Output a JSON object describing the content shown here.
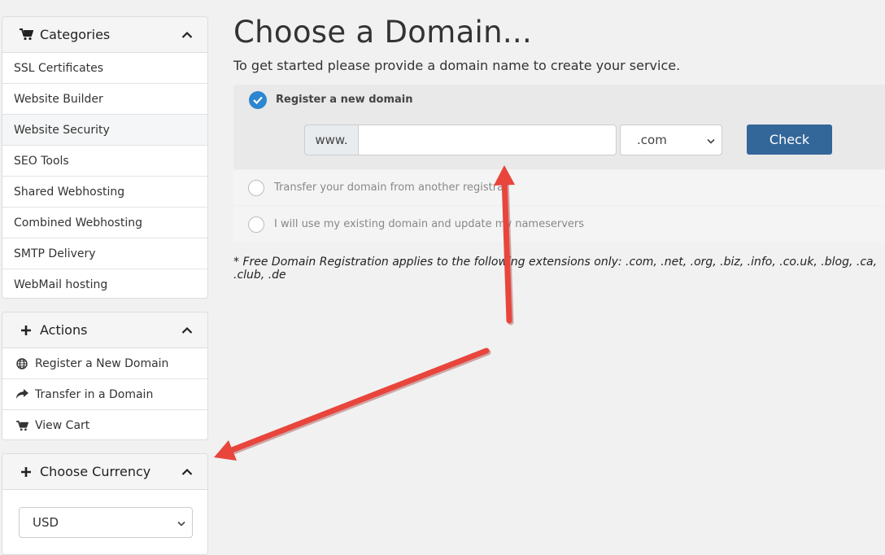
{
  "sidebar": {
    "categories": {
      "title": "Categories",
      "items": [
        {
          "label": "SSL Certificates"
        },
        {
          "label": "Website Builder"
        },
        {
          "label": "Website Security"
        },
        {
          "label": "SEO Tools"
        },
        {
          "label": "Shared Webhosting"
        },
        {
          "label": "Combined Webhosting"
        },
        {
          "label": "SMTP Delivery"
        },
        {
          "label": "WebMail hosting"
        }
      ]
    },
    "actions": {
      "title": "Actions",
      "items": [
        {
          "label": "Register a New Domain",
          "icon": "globe-icon"
        },
        {
          "label": "Transfer in a Domain",
          "icon": "share-arrow-icon"
        },
        {
          "label": "View Cart",
          "icon": "cart-icon"
        }
      ]
    },
    "currency": {
      "title": "Choose Currency",
      "selected": "USD"
    }
  },
  "main": {
    "title": "Choose a Domain...",
    "subtitle": "To get started please provide a domain name to create your service.",
    "options": [
      {
        "label": "Register a new domain",
        "selected": true
      },
      {
        "label": "Transfer your domain from another registrar",
        "selected": false
      },
      {
        "label": "I will use my existing domain and update my nameservers",
        "selected": false
      }
    ],
    "www_prefix": "www.",
    "domain_value": "",
    "tld_selected": ".com",
    "check_label": "Check",
    "note": "* Free Domain Registration applies to the following extensions only: .com, .net, .org, .biz, .info, .co.uk, .blog, .ca, .club, .de"
  },
  "colors": {
    "accent_blue": "#2d86cf",
    "button_blue": "#336699",
    "annotation_arrow": "#e8453c"
  }
}
